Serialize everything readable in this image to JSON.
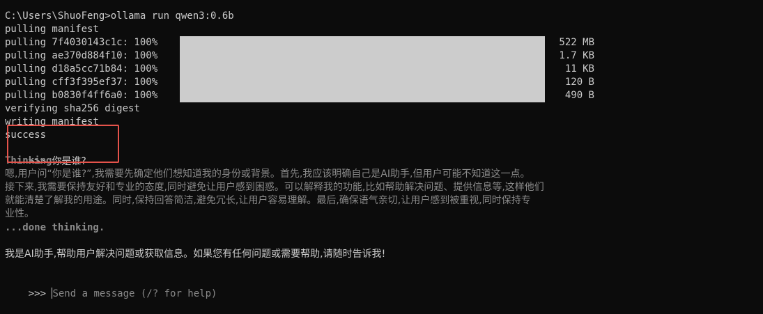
{
  "terminal": {
    "command_line": "C:\\Users\\ShuoFeng>ollama run qwen3:0.6b",
    "pulling_manifest": "pulling manifest",
    "pulls": [
      {
        "label": "pulling 7f4030143c1c: 100%",
        "progress": 1.0,
        "size": "522 MB"
      },
      {
        "label": "pulling ae370d884f10: 100%",
        "progress": 1.0,
        "size": "1.7 KB"
      },
      {
        "label": "pulling d18a5cc71b84: 100%",
        "progress": 1.0,
        "size": "11 KB"
      },
      {
        "label": "pulling cff3f395ef37: 100%",
        "progress": 1.0,
        "size": "120 B"
      },
      {
        "label": "pulling b0830f4ff6a0: 100%",
        "progress": 1.0,
        "size": "490 B"
      }
    ],
    "verifying": "verifying sha256 digest",
    "writing": "writing manifest",
    "success": "success",
    "prompt_symbol": ">>> ",
    "user_question": "你是谁?",
    "thinking_header": "Thinking...",
    "thinking_lines": [
      "嗯,用户问“你是谁?”,我需要先确定他们想知道我的身份或背景。首先,我应该明确自己是AI助手,但用户可能不知道这一点。",
      "接下来,我需要保持友好和专业的态度,同时避免让用户感到困惑。可以解释我的功能,比如帮助解决问题、提供信息等,这样他们",
      "就能清楚了解我的用途。同时,保持回答简洁,避免冗长,让用户容易理解。最后,确保语气亲切,让用户感到被重视,同时保持专",
      "业性。"
    ],
    "done_thinking": "...done thinking.",
    "answer": "我是AI助手,帮助用户解决问题或获取信息。如果您有任何问题或需要帮助,请随时告诉我!",
    "input_prompt_symbol": ">>> ",
    "input_placeholder": "Send a message (/? for help)"
  },
  "colors": {
    "background": "#0c0c0c",
    "foreground": "#cccccc",
    "dim_text": "#8a8a8a",
    "progress_fill": "#cccccc",
    "highlight_border": "#e5534b"
  }
}
